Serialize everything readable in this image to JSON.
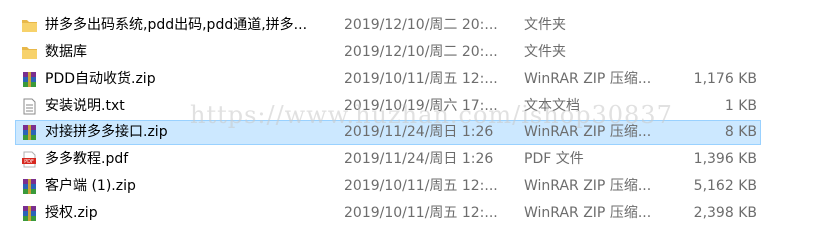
{
  "files": [
    {
      "name": "拼多多出码系统,pdd出码,pdd通道,拼多...",
      "date": "2019/12/10/周二 20:...",
      "type": "文件夹",
      "size": "",
      "icon": "folder-icon"
    },
    {
      "name": "数据库",
      "date": "2019/12/10/周二 20:...",
      "type": "文件夹",
      "size": "",
      "icon": "folder-icon"
    },
    {
      "name": "PDD自动收货.zip",
      "date": "2019/10/11/周五 12:...",
      "type": "WinRAR ZIP 压缩...",
      "size": "1,176 KB",
      "icon": "winrar-archive-icon"
    },
    {
      "name": "安装说明.txt",
      "date": "2019/10/19/周六 17:...",
      "type": "文本文档",
      "size": "1 KB",
      "icon": "text-document-icon"
    },
    {
      "name": "对接拼多多接口.zip",
      "date": "2019/11/24/周日 1:26",
      "type": "WinRAR ZIP 压缩...",
      "size": "8 KB",
      "icon": "winrar-archive-icon",
      "selected": true
    },
    {
      "name": "多多教程.pdf",
      "date": "2019/11/24/周日 1:26",
      "type": "PDF 文件",
      "size": "1,396 KB",
      "icon": "pdf-icon"
    },
    {
      "name": "客户端 (1).zip",
      "date": "2019/10/11/周五 12:...",
      "type": "WinRAR ZIP 压缩...",
      "size": "5,162 KB",
      "icon": "winrar-archive-icon"
    },
    {
      "name": "授权.zip",
      "date": "2019/10/11/周五 12:...",
      "type": "WinRAR ZIP 压缩...",
      "size": "2,398 KB",
      "icon": "winrar-archive-icon"
    }
  ],
  "watermark": "https://www.huzhan.com/ishop30837"
}
